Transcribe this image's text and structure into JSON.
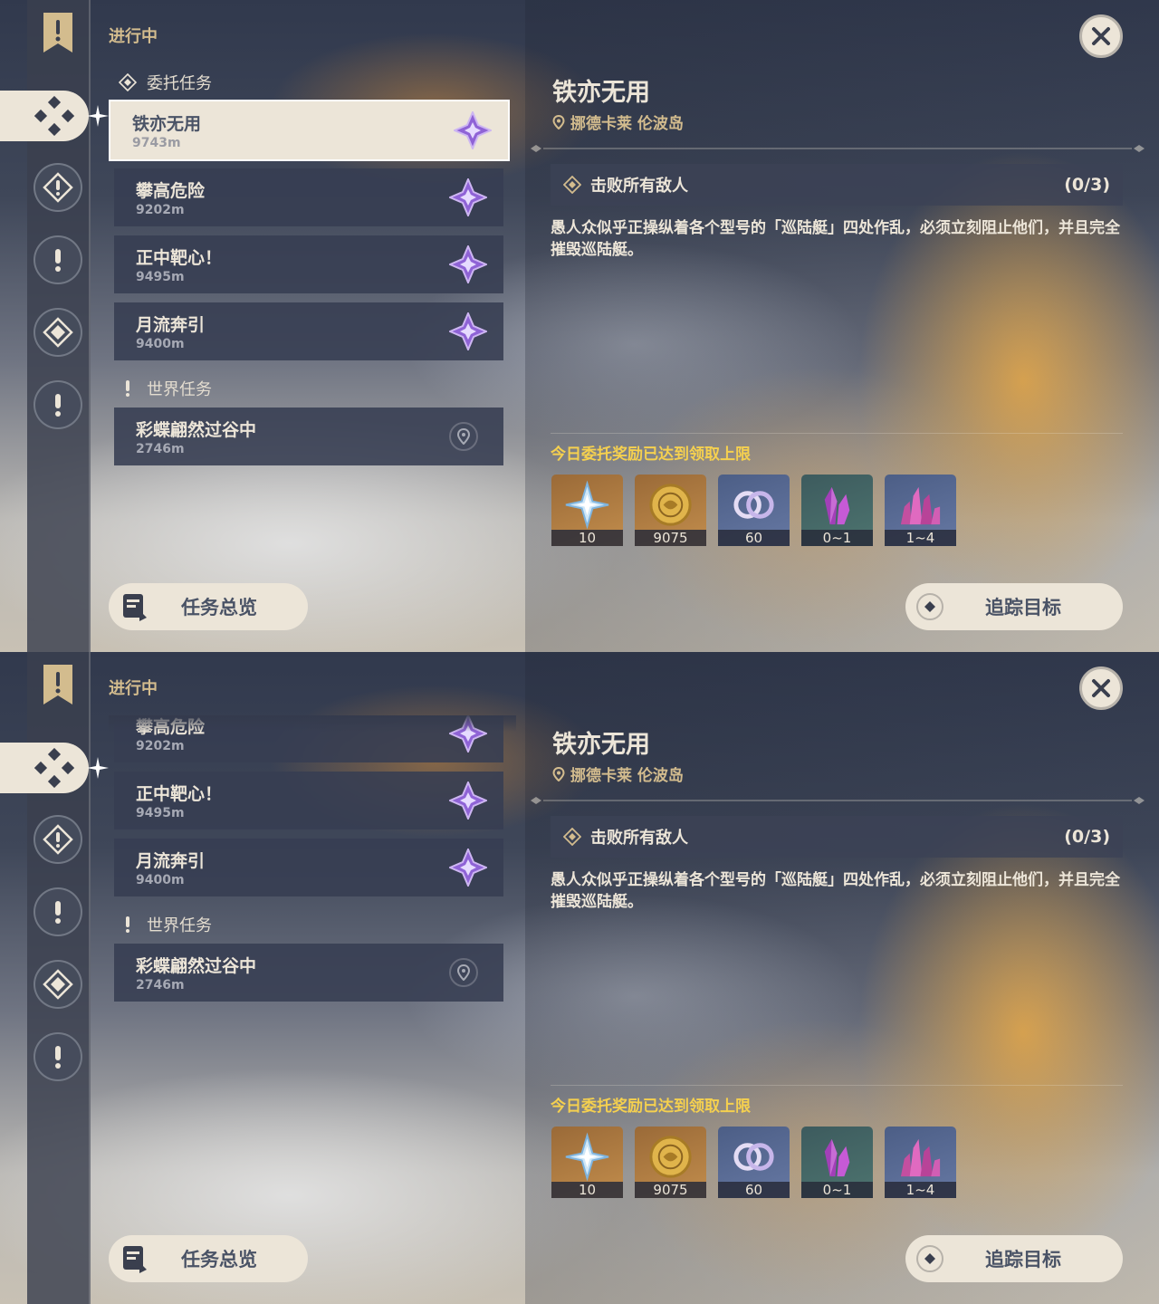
{
  "panels": [
    {
      "header": {
        "section_label": "进行中",
        "close_icon": "close-icon"
      },
      "list": {
        "categories": [
          {
            "label": "委托任务",
            "icon": "commission-diamond-icon"
          },
          {
            "label": "世界任务",
            "icon": "exclamation-icon"
          }
        ],
        "quests": [
          {
            "title": "铁亦无用",
            "distance": "9743m",
            "icon": "purple-star-icon",
            "selected": true
          },
          {
            "title": "攀高危险",
            "distance": "9202m",
            "icon": "purple-star-icon"
          },
          {
            "title": "正中靶心！",
            "distance": "9495m",
            "icon": "purple-star-icon"
          },
          {
            "title": "月流奔引",
            "distance": "9400m",
            "icon": "purple-star-icon"
          },
          {
            "title": "彩蝶翩然过谷中",
            "distance": "2746m",
            "icon": "map-pin-icon"
          }
        ]
      },
      "detail": {
        "title": "铁亦无用",
        "location": "挪德卡莱 伦波岛",
        "objective": {
          "text": "击败所有敌人",
          "count": "(0/3)"
        },
        "description": "愚人众似乎正操纵着各个型号的「巡陆艇」四处作乱，必须立刻阻止他们，并且完全摧毁巡陆艇。",
        "reward_note": "今日委托奖励已达到领取上限",
        "rewards": [
          {
            "amount": "10",
            "icon": "primogem-icon"
          },
          {
            "amount": "9075",
            "icon": "mora-coin-icon"
          },
          {
            "amount": "60",
            "icon": "companionship-exp-icon"
          },
          {
            "amount": "0~1",
            "icon": "purple-crystal-icon"
          },
          {
            "amount": "1~4",
            "icon": "purple-crystal-cluster-icon"
          }
        ]
      },
      "buttons": {
        "overview": "任务总览",
        "track": "追踪目标"
      }
    },
    {
      "header": {
        "section_label": "进行中",
        "close_icon": "close-icon"
      },
      "list": {
        "categories": [
          {
            "label": "世界任务",
            "icon": "exclamation-icon"
          }
        ],
        "quests": [
          {
            "title": "攀高危险",
            "distance": "9202m",
            "icon": "purple-star-icon"
          },
          {
            "title": "正中靶心！",
            "distance": "9495m",
            "icon": "purple-star-icon"
          },
          {
            "title": "月流奔引",
            "distance": "9400m",
            "icon": "purple-star-icon"
          },
          {
            "title": "彩蝶翩然过谷中",
            "distance": "2746m",
            "icon": "map-pin-icon"
          }
        ]
      },
      "detail": {
        "title": "铁亦无用",
        "location": "挪德卡莱 伦波岛",
        "objective": {
          "text": "击败所有敌人",
          "count": "(0/3)"
        },
        "description": "愚人众似乎正操纵着各个型号的「巡陆艇」四处作乱，必须立刻阻止他们，并且完全摧毁巡陆艇。",
        "reward_note": "今日委托奖励已达到领取上限",
        "rewards": [
          {
            "amount": "10",
            "icon": "primogem-icon"
          },
          {
            "amount": "9075",
            "icon": "mora-coin-icon"
          },
          {
            "amount": "60",
            "icon": "companionship-exp-icon"
          },
          {
            "amount": "0~1",
            "icon": "purple-crystal-icon"
          },
          {
            "amount": "1~4",
            "icon": "purple-crystal-cluster-icon"
          }
        ]
      },
      "buttons": {
        "overview": "任务总览",
        "track": "追踪目标"
      }
    }
  ],
  "colors": {
    "accent_gold": "#d3bc8e",
    "note_yellow": "#f5d04f",
    "cream": "#ece5d8",
    "dark_text": "#4a5366"
  }
}
